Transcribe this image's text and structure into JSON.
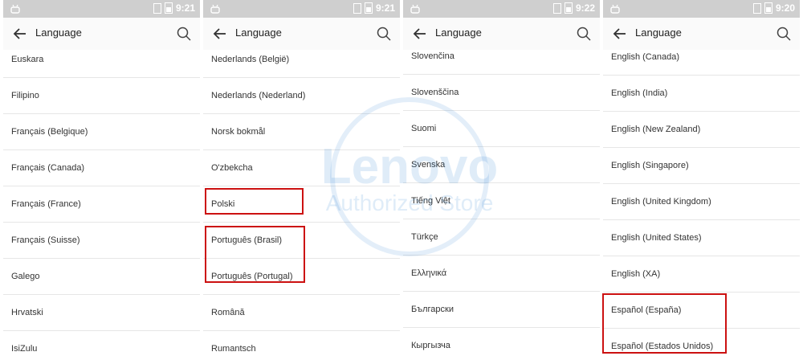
{
  "panels": [
    {
      "time": "9:21",
      "title": "Language",
      "items": [
        "Euskara",
        "Filipino",
        "Français (Belgique)",
        "Français (Canada)",
        "Français (France)",
        "Français (Suisse)",
        "Galego",
        "Hrvatski",
        "IsiZulu"
      ]
    },
    {
      "time": "9:21",
      "title": "Language",
      "items": [
        "Nederlands (België)",
        "Nederlands (Nederland)",
        "Norsk bokmål",
        "O'zbekcha",
        "Polski",
        "Português (Brasil)",
        "Português (Portugal)",
        "Română",
        "Rumantsch"
      ]
    },
    {
      "time": "9:22",
      "title": "Language",
      "items": [
        "Slovenčina",
        "Slovenščina",
        "Suomi",
        "Svenska",
        "Tiếng Việt",
        "Türkçe",
        "Ελληνικά",
        "Български",
        "Кыргызча"
      ]
    },
    {
      "time": "9:20",
      "title": "Language",
      "items": [
        "English (Canada)",
        "English (India)",
        "English (New Zealand)",
        "English (Singapore)",
        "English (United Kingdom)",
        "English (United States)",
        "English (XA)",
        "Español (España)",
        "Español (Estados Unidos)"
      ]
    }
  ],
  "watermark": {
    "brand": "Lenovo",
    "tagline": "Authorized Store"
  },
  "colors": {
    "status_bar": "#cfcfcf",
    "highlight": "#cc1111",
    "watermark": "#3a8ad6"
  }
}
